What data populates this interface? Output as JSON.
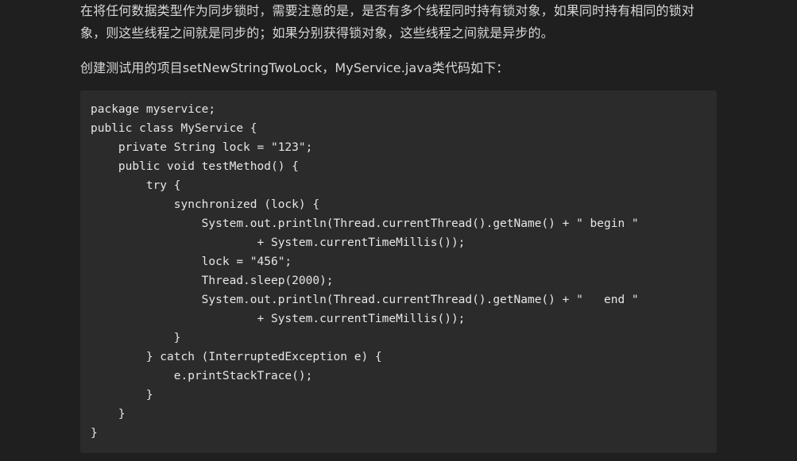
{
  "article": {
    "paragraph_1": "在将任何数据类型作为同步锁时，需要注意的是，是否有多个线程同时持有锁对象，如果同时持有相同的锁对象，则这些线程之间就是同步的；如果分别获得锁对象，这些线程之间就是异步的。",
    "paragraph_2": "创建测试用的项目setNewStringTwoLock，MyService.java类代码如下："
  },
  "code": {
    "lines": [
      "package myservice;",
      "public class MyService {",
      "    private String lock = \"123\";",
      "    public void testMethod() {",
      "        try {",
      "            synchronized (lock) {",
      "                System.out.println(Thread.currentThread().getName() + \" begin \"",
      "                        + System.currentTimeMillis());",
      "                lock = \"456\";",
      "                Thread.sleep(2000);",
      "                System.out.println(Thread.currentThread().getName() + \"   end \"",
      "                        + System.currentTimeMillis());",
      "            }",
      "        } catch (InterruptedException e) {",
      "            e.printStackTrace();",
      "        }",
      "    }",
      "}"
    ]
  }
}
